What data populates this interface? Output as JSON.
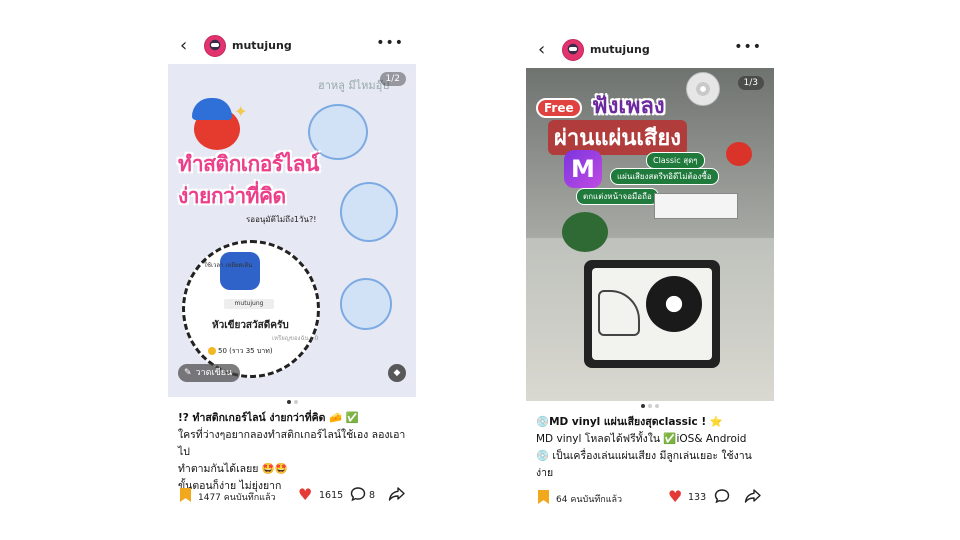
{
  "posts": [
    {
      "username": "mutujung",
      "counter": "1/2",
      "art": {
        "title_line1": "ทำสติกเกอร์ไลน์",
        "title_line2": "ง่ายกว่าที่คิด",
        "subtitle": "รออนุมัติไม่ถึง1วัน?!",
        "hand_note": "ฮาหลู มีไหมอุ๊ป",
        "sticker_note": "ใช้เวลา เหยียดเส้น",
        "card_label": "mutujung",
        "card_title": "หัวเขียวสวัสดีครับ",
        "price": "50 (ราว 35 บาท)",
        "price_note": "เหรียญของฉัน : 0",
        "draw_tag": "วาดเขียน"
      },
      "dots": 2,
      "active_dot": 0,
      "caption": [
        "!? ทำสติกเกอร์ไลน์ ง่ายกว่าที่คิด 🧀 ✅",
        "ใครที่ว่างๆอยากลองทำสติกเกอร์ไลน์ใช้เอง ลองเอาไป",
        "ทำตามกันได้เลยย 🤩🤩",
        "ขั้นตอนก็ง่าย ไม่ยุ่งยาก"
      ],
      "saves": "1477 คนบันทึกแล้ว",
      "likes": "1615",
      "comments": "8"
    },
    {
      "username": "mutujung",
      "counter": "1/3",
      "art": {
        "free": "Free",
        "title_line1": "ฟังเพลง",
        "title_line2": "ผ่านแผ่นเสียง",
        "logo": "M",
        "pill1": "Classic สุดๆ",
        "pill2": "แผ่นเสียงสตรีทอิดีไม่ต้องซื้อ",
        "pill3": "ตกแต่งหน้าจอมือถือ"
      },
      "dots": 3,
      "active_dot": 0,
      "caption": [
        "💿MD vinyl แผ่นเสียงสุดclassic ! ⭐",
        "MD vinyl โหลดได้ฟรีทั้งใน ✅iOS& Android",
        "💿 เป็นเครื่องเล่นแผ่นเสียง มีลูกเล่นเยอะ ใช้งานง่าย"
      ],
      "saves": "64 คนบันทึกแล้ว",
      "likes": "133",
      "comments": ""
    }
  ],
  "icons": {
    "back": "chevron-left-icon",
    "more": "ellipsis-icon",
    "bookmark": "bookmark-icon",
    "heart": "heart-icon",
    "comment": "comment-icon",
    "share": "share-icon",
    "tag": "tag-icon",
    "pen": "pen-icon"
  },
  "colors": {
    "heart": "#e53935",
    "bookmark": "#f2a81d",
    "title_pink": "#ec3f8b",
    "free_red": "#e0433f"
  }
}
